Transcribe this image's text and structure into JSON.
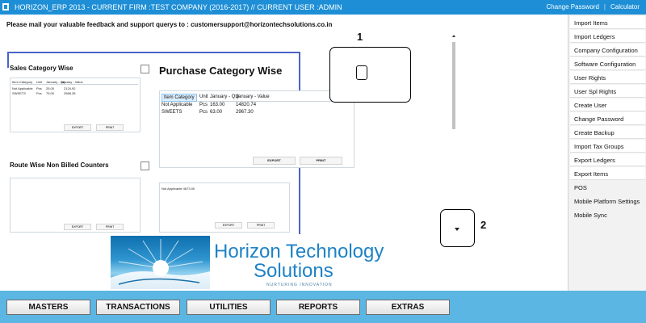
{
  "titlebar": {
    "title": "HORIZON_ERP 2013 - CURRENT FIRM :TEST COMPANY (2016-2017) // CURRENT USER :ADMIN",
    "links": [
      "Change Password",
      "|",
      "Calculator"
    ]
  },
  "feedback": "Please mail your valuable feedback and support querys to : customersupport@horizontechsolutions.co.in",
  "right_menu": [
    "Import Items",
    "Import Ledgers",
    "Company Configuration",
    "Software Configuration",
    "User Rights",
    "User Spl Rights",
    "Create User",
    "Change Password",
    "Create Backup",
    "Import Tax Groups",
    "Export Ledgers",
    "Export Items",
    "POS",
    "Mobile Platform Settings",
    "Mobile Sync"
  ],
  "sales_category": {
    "title": "Sales Category Wise",
    "headers": [
      "Item Category",
      "Unit",
      "January - Qty",
      "January - Value"
    ],
    "rows": [
      [
        "Not Applicable",
        "Pcs",
        "25.00",
        "2124.92"
      ],
      [
        "SWEETS",
        "Pcs",
        "75.00",
        "2568.35"
      ]
    ],
    "buttons": [
      "EXPORT",
      "PRINT"
    ]
  },
  "purchase_category": {
    "title": "Purchase Category Wise",
    "headers": [
      "Item Category",
      "Unit",
      "January - Qty",
      "January - Value"
    ],
    "rows": [
      [
        "Not Applicable",
        "Pcs",
        "163.00",
        "14820.74"
      ],
      [
        "SWEETS",
        "Pcs",
        "63.00",
        "2967.30"
      ]
    ],
    "buttons": [
      "EXPORT",
      "PRINT"
    ]
  },
  "route_wise": {
    "title": "Route Wise Non Billed Counters",
    "buttons": [
      "EXPORT",
      "PRINT"
    ]
  },
  "lower_right_panel": {
    "row": "Not Applicable 4673.00",
    "buttons": [
      "EXPORT",
      "PRINT"
    ]
  },
  "callouts": [
    "1",
    "2"
  ],
  "logo": {
    "line1": "Horizon Technology",
    "line2": "Solutions",
    "tagline": "NURTURING INNOVATION"
  },
  "nav": [
    "MASTERS",
    "TRANSACTIONS",
    "UTILITIES",
    "REPORTS",
    "EXTRAS"
  ],
  "colors": {
    "titlebar": "#1e8fd6",
    "bottom_bar": "#5bb6e3",
    "accent": "#4a64c8"
  }
}
